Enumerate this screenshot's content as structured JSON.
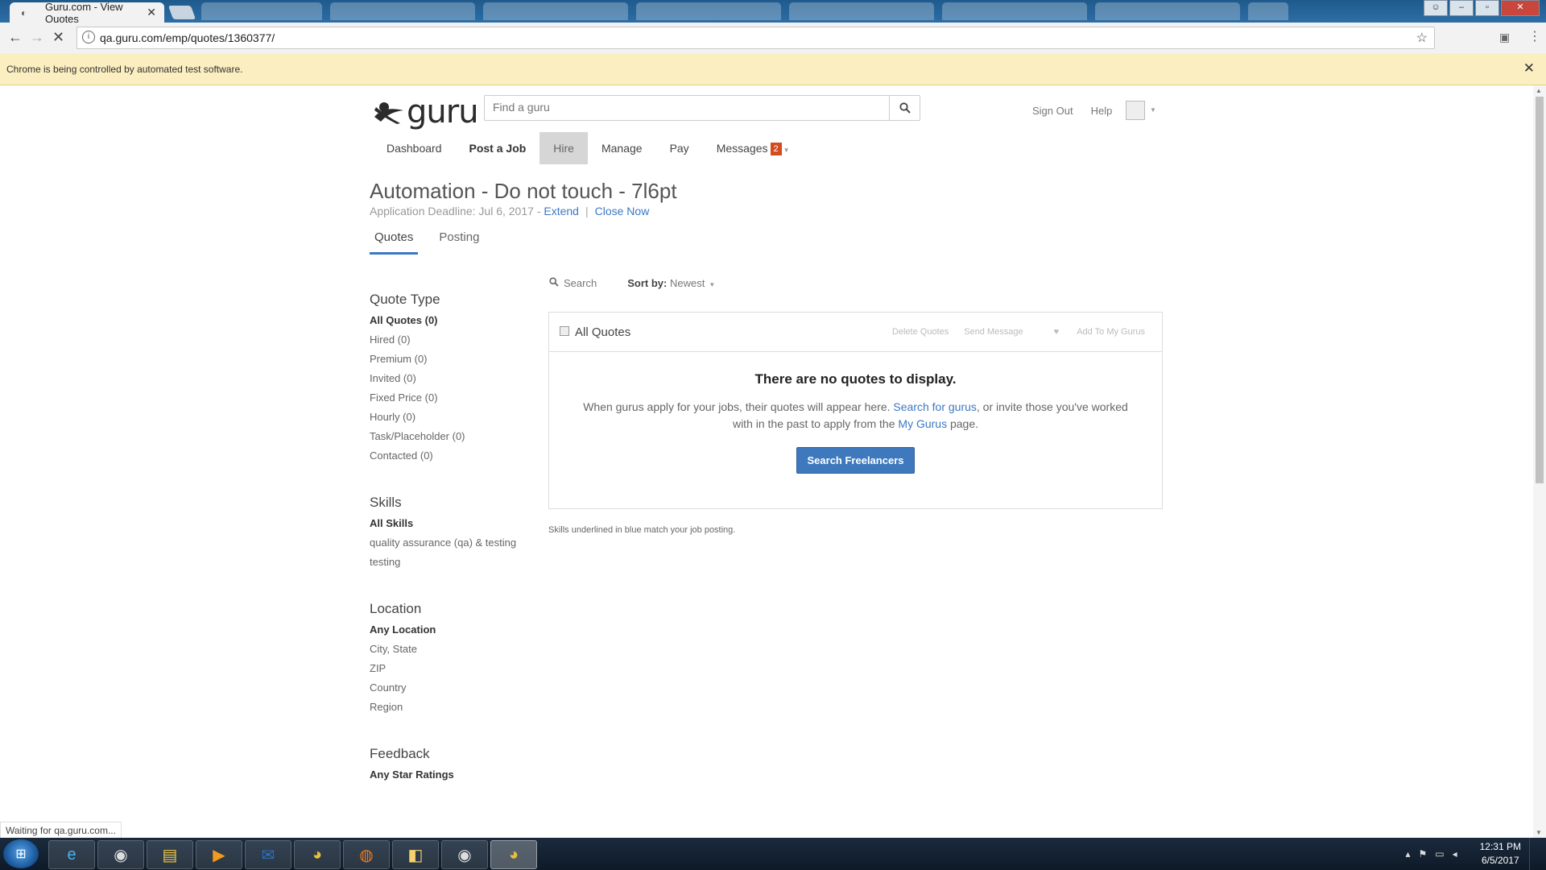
{
  "browser": {
    "active_tab_title": "Guru.com - View Quotes",
    "tab_close": "✕",
    "url": "qa.guru.com/emp/quotes/1360377/",
    "infobar_message": "Chrome is being controlled by automated test software.",
    "status_text": "Waiting for qa.guru.com..."
  },
  "header": {
    "logo_text": "guru",
    "search_placeholder": "Find a guru",
    "sign_out": "Sign Out",
    "help": "Help"
  },
  "nav": {
    "dashboard": "Dashboard",
    "post_job": "Post a Job",
    "hire": "Hire",
    "manage": "Manage",
    "pay": "Pay",
    "messages": "Messages",
    "messages_count": "2"
  },
  "job": {
    "title": "Automation - Do not touch - 7l6pt",
    "deadline_label": "Application Deadline: Jul 6, 2017",
    "dash": "-",
    "extend": "Extend",
    "divider": "|",
    "close_now": "Close Now"
  },
  "subtabs": {
    "quotes": "Quotes",
    "posting": "Posting"
  },
  "sidebar": {
    "quote_type": {
      "heading": "Quote Type",
      "items": [
        "All Quotes (0)",
        "Hired (0)",
        "Premium (0)",
        "Invited (0)",
        "Fixed Price (0)",
        "Hourly (0)",
        "Task/Placeholder (0)",
        "Contacted (0)"
      ]
    },
    "skills": {
      "heading": "Skills",
      "items": [
        "All Skills",
        "quality assurance (qa) & testing",
        "testing"
      ]
    },
    "location": {
      "heading": "Location",
      "items": [
        "Any Location",
        "City, State",
        "ZIP",
        "Country",
        "Region"
      ]
    },
    "feedback": {
      "heading": "Feedback",
      "items": [
        "Any Star Ratings"
      ]
    }
  },
  "toolbar": {
    "search_label": "Search",
    "sort_label": "Sort by:",
    "sort_value": "Newest"
  },
  "panel": {
    "title": "All Quotes",
    "actions": [
      "Delete Quotes",
      "Send Message",
      "Add To My Gurus"
    ],
    "empty_title": "There are no quotes to display.",
    "empty_text_1": "When gurus apply for your jobs, their quotes will appear here.",
    "link_search": "Search for gurus",
    "empty_text_2": ", or invite those you've worked with in the past to apply from the",
    "link_my_gurus": "My Gurus",
    "empty_text_3": "page.",
    "button": "Search Freelancers"
  },
  "footnote": "Skills underlined in blue match your job posting.",
  "taskbar": {
    "time": "12:31 PM",
    "date": "6/5/2017"
  },
  "colors": {
    "accent": "#3c78c3",
    "button": "#3f79bd",
    "badge": "#d44b1f",
    "infobar": "#fbeec0"
  }
}
